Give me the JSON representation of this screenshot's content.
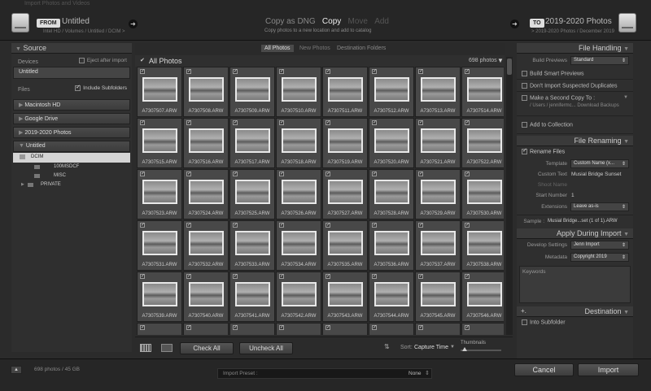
{
  "window": {
    "title": "Import Photos and Videos"
  },
  "source_bar": {
    "tag": "FROM",
    "name": "Untitled",
    "path": "Intel HD / Volumes / Untitled / DCIM >"
  },
  "modes": {
    "items": [
      "Copy as DNG",
      "Copy",
      "Move",
      "Add"
    ],
    "subtitle": "Copy photos to a new location and add to catalog"
  },
  "dest_bar": {
    "tag": "TO",
    "name": "2019-2020 Photos",
    "path": "> 2019-2020 Photos / December 2019"
  },
  "source_panel": {
    "title": "Source",
    "devices_label": "Devices",
    "eject_label": "Eject after import",
    "device": "Untitled",
    "files_label": "Files",
    "include_subfolders": "Include Subfolders",
    "drives": [
      "Macintosh HD",
      "Google Drive",
      "2019-2020 Photos"
    ],
    "open_drive": "Untitled",
    "folders": [
      {
        "name": "DCIM",
        "level": 1
      },
      {
        "name": "100MSDCF",
        "level": 2
      },
      {
        "name": "MISC",
        "level": 2
      },
      {
        "name": "PRIVATE",
        "level": 1
      }
    ]
  },
  "filter_tabs": [
    "All Photos",
    "New Photos",
    "Destination Folders"
  ],
  "grid": {
    "header": "All Photos",
    "count": "698 photos",
    "rows": [
      [
        "A7307507.ARW",
        "A7307508.ARW",
        "A7307509.ARW",
        "A7307510.ARW",
        "A7307511.ARW",
        "A7307512.ARW",
        "A7307513.ARW",
        "A7307514.ARW"
      ],
      [
        "A7307515.ARW",
        "A7307516.ARW",
        "A7307517.ARW",
        "A7307518.ARW",
        "A7307519.ARW",
        "A7307520.ARW",
        "A7307521.ARW",
        "A7307522.ARW"
      ],
      [
        "A7307523.ARW",
        "A7307524.ARW",
        "A7307525.ARW",
        "A7307526.ARW",
        "A7307527.ARW",
        "A7307528.ARW",
        "A7307529.ARW",
        "A7307530.ARW"
      ],
      [
        "A7307531.ARW",
        "A7307532.ARW",
        "A7307533.ARW",
        "A7307534.ARW",
        "A7307535.ARW",
        "A7307536.ARW",
        "A7307537.ARW",
        "A7307538.ARW"
      ],
      [
        "A7307539.ARW",
        "A7307540.ARW",
        "A7307541.ARW",
        "A7307542.ARW",
        "A7307543.ARW",
        "A7307544.ARW",
        "A7307545.ARW",
        "A7307546.ARW"
      ]
    ]
  },
  "toolbar": {
    "check_all": "Check All",
    "uncheck_all": "Uncheck All",
    "sort_label": "Sort:",
    "sort_value": "Capture Time",
    "thumbnails_label": "Thumbnails"
  },
  "file_handling": {
    "title": "File Handling",
    "build_previews_label": "Build Previews",
    "build_previews_value": "Standard",
    "smart_previews": "Build Smart Previews",
    "no_duplicates": "Don't Import Suspected Duplicates",
    "second_copy": "Make a Second Copy To :",
    "second_copy_path": "/ Users / jennifermc... Download Backups",
    "add_collection": "Add to Collection"
  },
  "file_renaming": {
    "title": "File Renaming",
    "rename_files": "Rename Files",
    "template_label": "Template",
    "template_value": "Custom Name (x...",
    "custom_text_label": "Custom Text",
    "custom_text_value": "Musial Bridge Sunset",
    "shoot_name_label": "Shoot Name",
    "start_number_label": "Start Number",
    "start_number_value": "1",
    "extensions_label": "Extensions",
    "extensions_value": "Leave as-is",
    "sample_label": "Sample :",
    "sample_value": "Musial Bridge...set (1 of 1).ARW"
  },
  "apply_during_import": {
    "title": "Apply During Import",
    "develop_label": "Develop Settings",
    "develop_value": "Jenn Import",
    "metadata_label": "Metadata",
    "metadata_value": "Copyright 2019",
    "keywords_label": "Keywords"
  },
  "destination": {
    "title": "Destination",
    "into_subfolder": "Into Subfolder"
  },
  "footer": {
    "status": "698 photos / 45 GB",
    "preset_label": "Import Preset :",
    "preset_value": "None",
    "cancel": "Cancel",
    "import": "Import"
  }
}
